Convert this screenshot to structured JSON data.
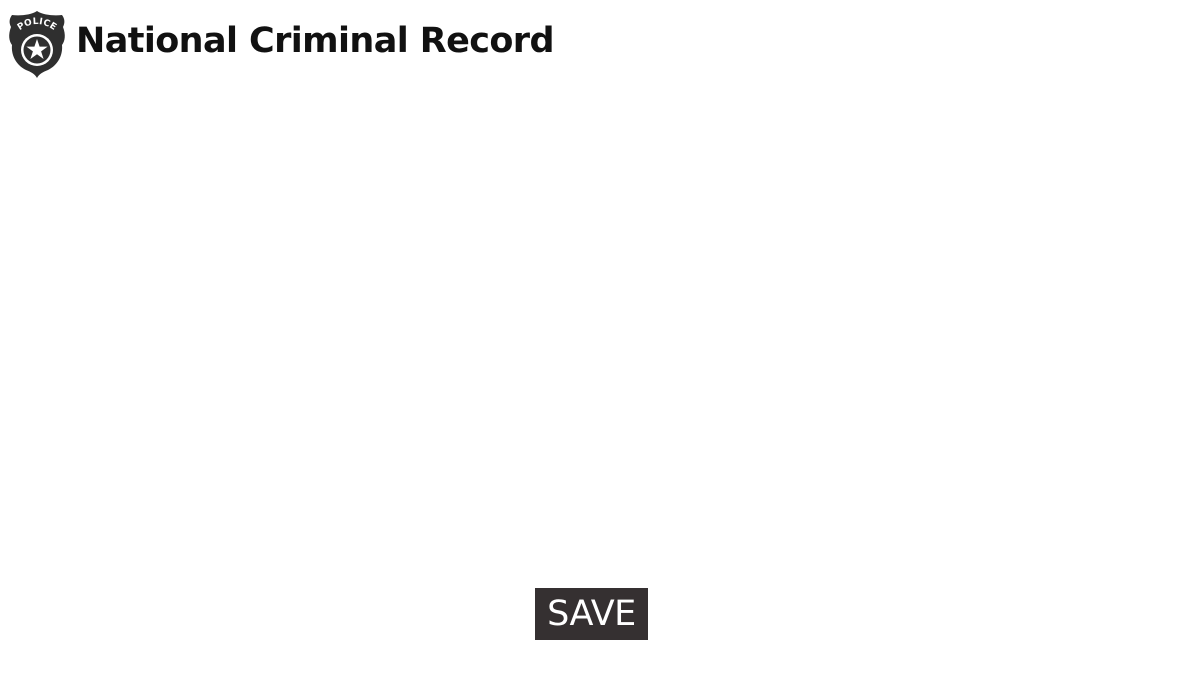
{
  "header": {
    "title": "National Criminal Record",
    "logo": {
      "icon": "police-badge-icon",
      "text": "POLICE"
    }
  },
  "actions": {
    "save_label": "SAVE"
  },
  "colors": {
    "background": "#ffffff",
    "title_text": "#111111",
    "badge": "#2f2f2f",
    "button_background": "#353031",
    "button_text": "#ffffff"
  }
}
